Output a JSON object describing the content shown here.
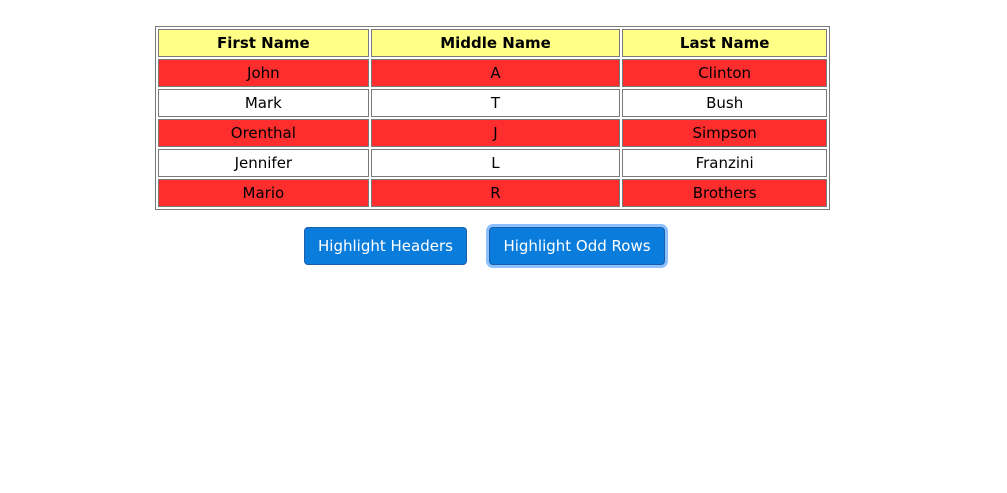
{
  "colors": {
    "header_bg": "#ffff88",
    "odd_row_bg": "#ff2e2e",
    "even_row_bg": "#ffffff",
    "button_bg": "#0a7ddc",
    "button_focus_ring": "#8cc0ff"
  },
  "table": {
    "headers": [
      "First Name",
      "Middle Name",
      "Last Name"
    ],
    "rows": [
      [
        "John",
        "A",
        "Clinton"
      ],
      [
        "Mark",
        "T",
        "Bush"
      ],
      [
        "Orenthal",
        "J",
        "Simpson"
      ],
      [
        "Jennifer",
        "L",
        "Franzini"
      ],
      [
        "Mario",
        "R",
        "Brothers"
      ]
    ],
    "highlighted_rows": [
      0,
      2,
      4
    ]
  },
  "buttons": {
    "highlight_headers": "Highlight Headers",
    "highlight_odd_rows": "Highlight Odd Rows",
    "focused": "highlight_odd_rows"
  }
}
